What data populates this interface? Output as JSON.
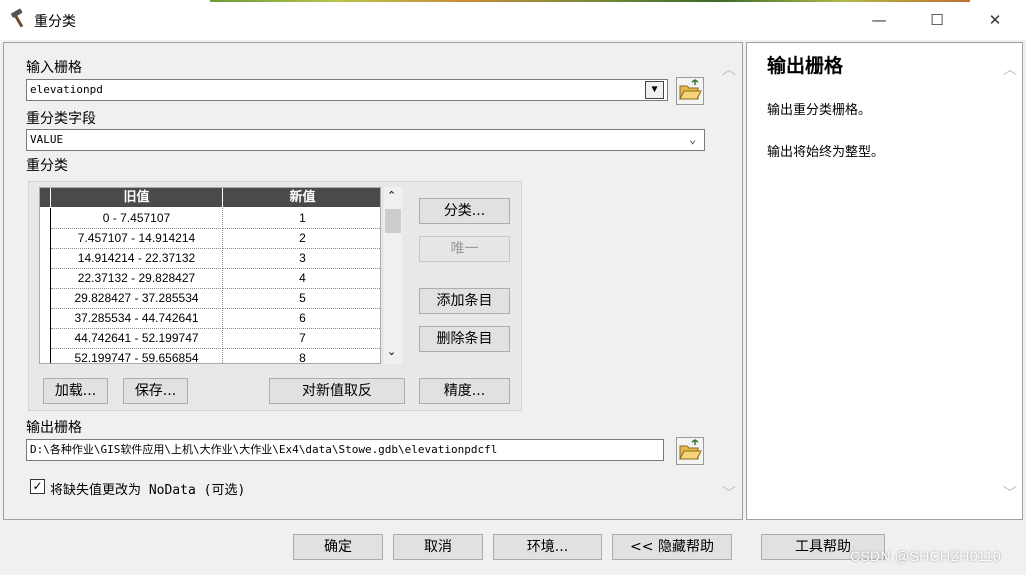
{
  "window": {
    "title": "重分类",
    "app_icon": "hammer-icon",
    "controls": {
      "minimize": "—",
      "maximize": "☐",
      "close": "✕"
    }
  },
  "form": {
    "input_raster_label": "输入栅格",
    "input_raster_value": "elevationpd",
    "reclass_field_label": "重分类字段",
    "reclass_field_value": "VALUE",
    "reclass_label": "重分类",
    "table": {
      "headers": [
        "旧值",
        "新值"
      ],
      "rows": [
        {
          "old": "0 - 7.457107",
          "new": "1"
        },
        {
          "old": "7.457107 - 14.914214",
          "new": "2"
        },
        {
          "old": "14.914214 - 22.37132",
          "new": "3"
        },
        {
          "old": "22.37132 - 29.828427",
          "new": "4"
        },
        {
          "old": "29.828427 - 37.285534",
          "new": "5"
        },
        {
          "old": "37.285534 - 44.742641",
          "new": "6"
        },
        {
          "old": "44.742641 - 52.199747",
          "new": "7"
        },
        {
          "old": "52.199747 - 59.656854",
          "new": "8"
        }
      ]
    },
    "buttons": {
      "classify": "分类...",
      "unique": "唯一",
      "add_entry": "添加条目",
      "delete_entry": "删除条目",
      "load": "加载...",
      "save": "保存...",
      "reverse": "对新值取反",
      "precision": "精度..."
    },
    "output_raster_label": "输出栅格",
    "output_raster_value": "D:\\各种作业\\GIS软件应用\\上机\\大作业\\大作业\\Ex4\\data\\Stowe.gdb\\elevationpdcfl",
    "nodata_checkbox_label": "将缺失值更改为 NoData (可选)",
    "nodata_checked": true
  },
  "help": {
    "title": "输出栅格",
    "paragraphs": [
      "输出重分类栅格。",
      "输出将始终为整型。"
    ]
  },
  "footer": {
    "ok": "确定",
    "cancel": "取消",
    "environments": "环境...",
    "hide_help": "<< 隐藏帮助",
    "tool_help": "工具帮助"
  },
  "watermark": "CSDN @SHCHZH0110"
}
